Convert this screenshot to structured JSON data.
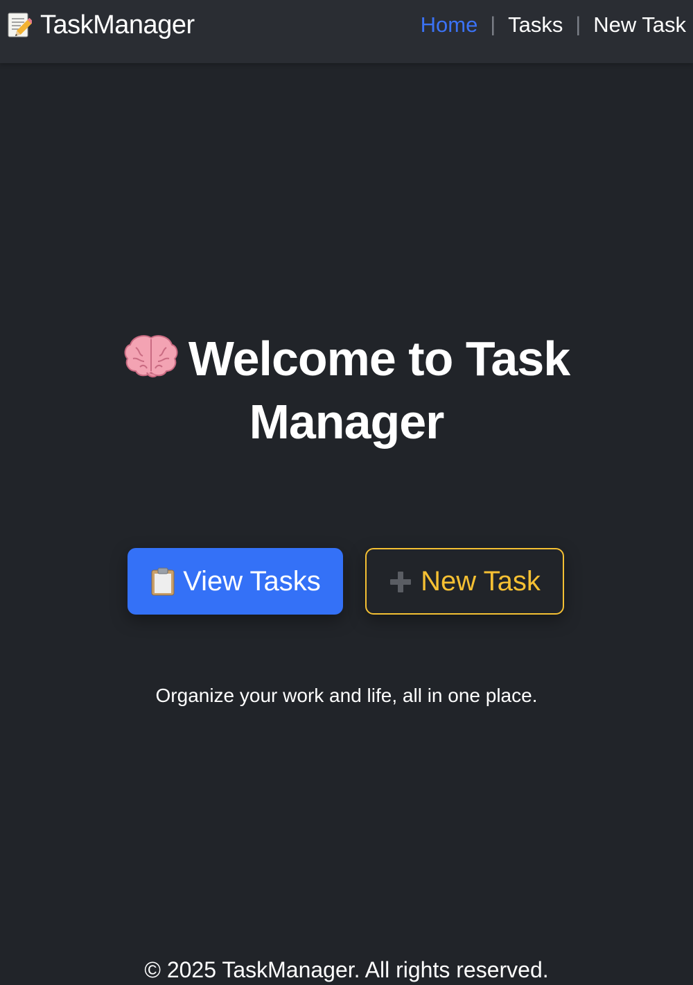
{
  "brand": {
    "icon": "memo-icon",
    "name": "TaskManager"
  },
  "nav": {
    "items": [
      {
        "label": "Home",
        "active": true
      },
      {
        "label": "Tasks",
        "active": false
      },
      {
        "label": "New Task",
        "active": false
      }
    ],
    "separator": "|"
  },
  "hero": {
    "icon": "brain-icon",
    "title": "Welcome to Task Manager"
  },
  "actions": {
    "view_tasks": {
      "icon": "clipboard-icon",
      "label": "View Tasks"
    },
    "new_task": {
      "icon": "plus-icon",
      "label": "New Task"
    }
  },
  "tagline": "Organize your work and life, all in one place.",
  "footer": "© 2025 TaskManager. All rights reserved.",
  "colors": {
    "background": "#212429",
    "navbar": "#2a2d33",
    "accent_blue": "#3471f7",
    "accent_yellow": "#f5c033",
    "text": "#ffffff"
  }
}
